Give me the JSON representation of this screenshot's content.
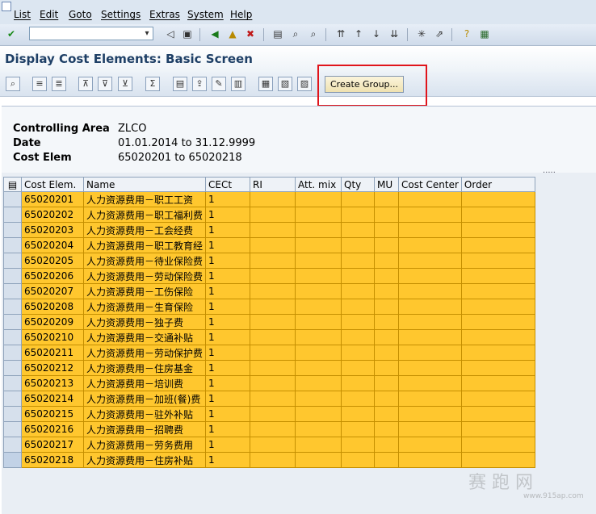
{
  "menu": [
    "List",
    "Edit",
    "Goto",
    "Settings",
    "Extras",
    "System",
    "Help"
  ],
  "command_field": {
    "value": ""
  },
  "title": "Display Cost Elements: Basic Screen",
  "app_toolbar": {
    "create_group_label": "Create Group..."
  },
  "header": {
    "rows": [
      {
        "label": "Controlling Area",
        "value": "ZLCO"
      },
      {
        "label": "Date",
        "value": "01.01.2014 to 31.12.9999"
      },
      {
        "label": "Cost Elem",
        "value": "65020201 to 65020218"
      }
    ]
  },
  "grid": {
    "columns": [
      "Cost Elem.",
      "Name",
      "CECt",
      "RI",
      "Att. mix",
      "Qty",
      "MU",
      "Cost Center",
      "Order"
    ],
    "rows": [
      {
        "cost_elem": "65020201",
        "name": "人力资源费用－职工工资",
        "cect": "1"
      },
      {
        "cost_elem": "65020202",
        "name": "人力资源费用－职工福利费",
        "cect": "1"
      },
      {
        "cost_elem": "65020203",
        "name": "人力资源费用－工会经费",
        "cect": "1"
      },
      {
        "cost_elem": "65020204",
        "name": "人力资源费用－职工教育经",
        "cect": "1"
      },
      {
        "cost_elem": "65020205",
        "name": "人力资源费用－待业保险费",
        "cect": "1"
      },
      {
        "cost_elem": "65020206",
        "name": "人力资源费用－劳动保险费",
        "cect": "1"
      },
      {
        "cost_elem": "65020207",
        "name": "人力资源费用－工伤保险",
        "cect": "1"
      },
      {
        "cost_elem": "65020208",
        "name": "人力资源费用－生育保险",
        "cect": "1"
      },
      {
        "cost_elem": "65020209",
        "name": "人力资源费用－独子费",
        "cect": "1"
      },
      {
        "cost_elem": "65020210",
        "name": "人力资源费用－交通补贴",
        "cect": "1"
      },
      {
        "cost_elem": "65020211",
        "name": "人力资源费用－劳动保护费",
        "cect": "1"
      },
      {
        "cost_elem": "65020212",
        "name": "人力资源费用－住房基金",
        "cect": "1"
      },
      {
        "cost_elem": "65020213",
        "name": "人力资源费用－培训费",
        "cect": "1"
      },
      {
        "cost_elem": "65020214",
        "name": "人力资源费用－加班(餐)费",
        "cect": "1"
      },
      {
        "cost_elem": "65020215",
        "name": "人力资源费用－驻外补贴",
        "cect": "1"
      },
      {
        "cost_elem": "65020216",
        "name": "人力资源费用－招聘费",
        "cect": "1"
      },
      {
        "cost_elem": "65020217",
        "name": "人力资源费用－劳务费用",
        "cect": "1"
      },
      {
        "cost_elem": "65020218",
        "name": "人力资源费用－住房补贴",
        "cect": "1"
      }
    ]
  },
  "watermark": {
    "text": "赛 跑 网",
    "url": "www.915ap.com"
  },
  "colors": {
    "row_bg": "#ffc72e",
    "title": "#1e3f66",
    "highlight": "#e0141b"
  }
}
